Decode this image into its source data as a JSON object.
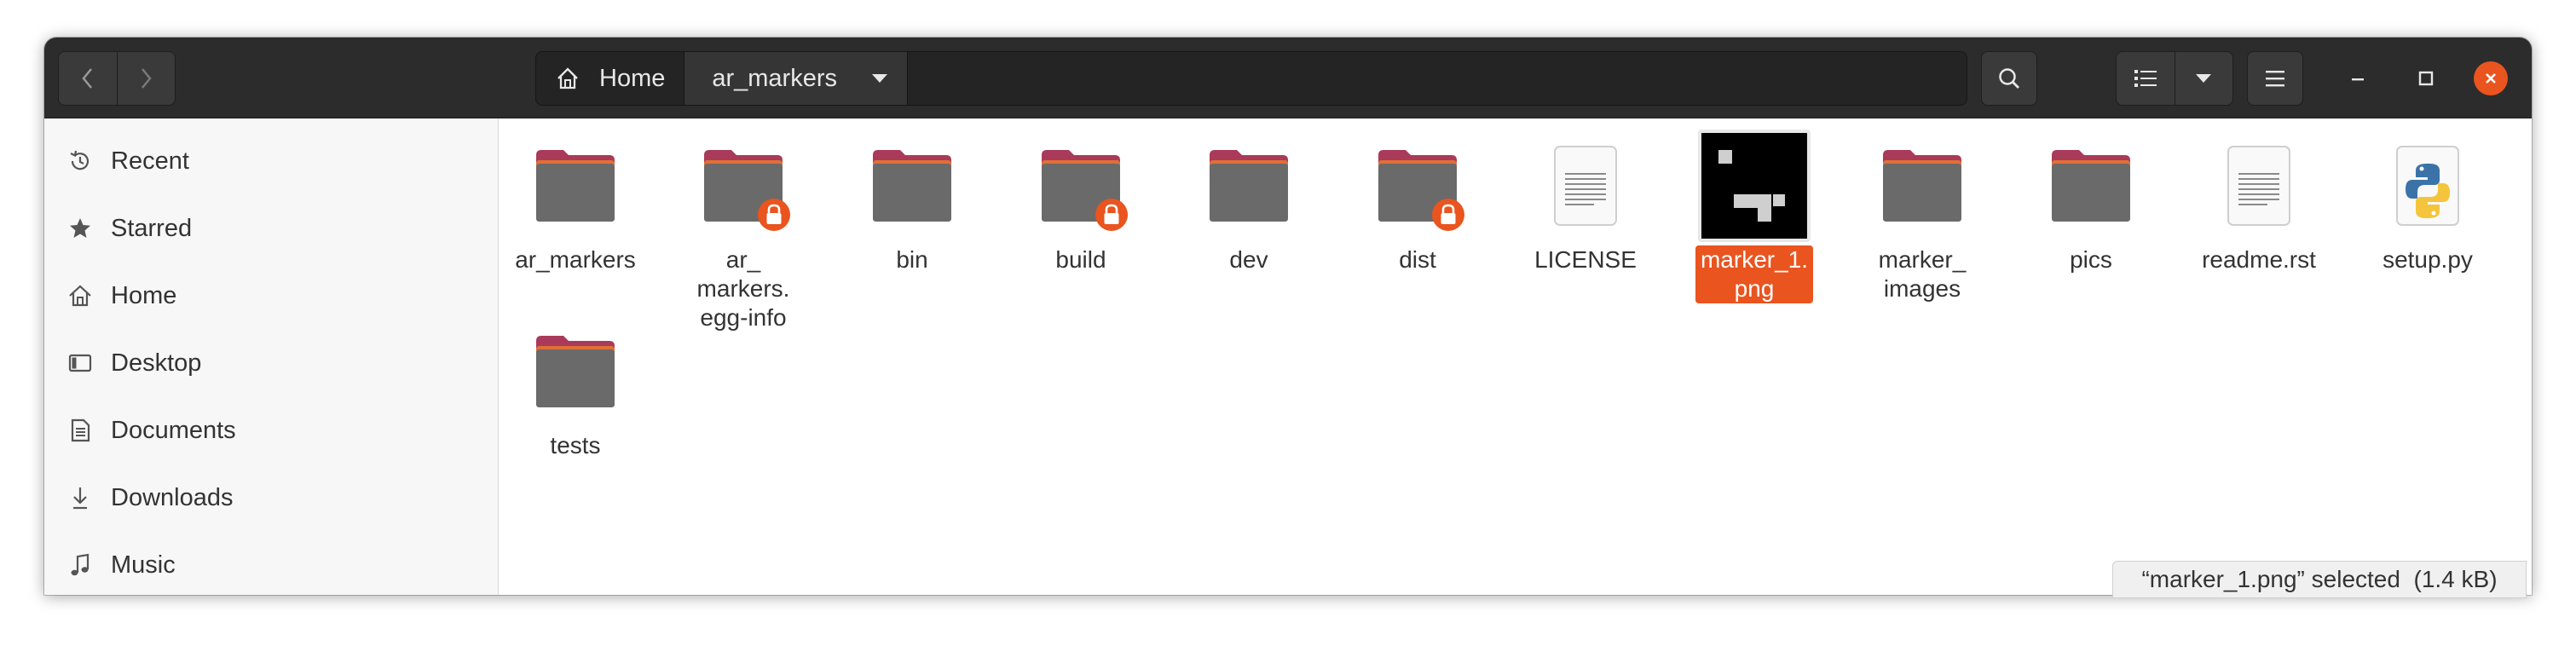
{
  "pathbar": {
    "home_label": "Home",
    "current_label": "ar_markers"
  },
  "sidebar": {
    "items": [
      {
        "label": "Recent",
        "icon": "clock-icon"
      },
      {
        "label": "Starred",
        "icon": "star-icon"
      },
      {
        "label": "Home",
        "icon": "home-icon"
      },
      {
        "label": "Desktop",
        "icon": "desktop-icon"
      },
      {
        "label": "Documents",
        "icon": "document-icon"
      },
      {
        "label": "Downloads",
        "icon": "download-icon"
      },
      {
        "label": "Music",
        "icon": "music-icon"
      }
    ]
  },
  "files": [
    {
      "lines": [
        "ar_markers"
      ],
      "type": "folder",
      "locked": false
    },
    {
      "lines": [
        "ar_",
        "markers.",
        "egg-info"
      ],
      "type": "folder",
      "locked": true
    },
    {
      "lines": [
        "bin"
      ],
      "type": "folder",
      "locked": false
    },
    {
      "lines": [
        "build"
      ],
      "type": "folder",
      "locked": true
    },
    {
      "lines": [
        "dev"
      ],
      "type": "folder",
      "locked": false
    },
    {
      "lines": [
        "dist"
      ],
      "type": "folder",
      "locked": true
    },
    {
      "lines": [
        "LICENSE"
      ],
      "type": "text",
      "locked": false
    },
    {
      "lines": [
        "marker_1.",
        "png"
      ],
      "type": "image",
      "locked": false,
      "selected": true
    },
    {
      "lines": [
        "marker_",
        "images"
      ],
      "type": "folder",
      "locked": false
    },
    {
      "lines": [
        "pics"
      ],
      "type": "folder",
      "locked": false
    },
    {
      "lines": [
        "readme.rst"
      ],
      "type": "text",
      "locked": false
    },
    {
      "lines": [
        "setup.py"
      ],
      "type": "python",
      "locked": false
    },
    {
      "lines": [
        "tests"
      ],
      "type": "folder",
      "locked": false
    }
  ],
  "status": {
    "text": "“marker_1.png” selected  (1.4 kB)"
  },
  "colors": {
    "accent": "#e9541f",
    "headerbar": "#2c2c2c",
    "folder_tab": "#a93a5a",
    "folder_body": "#6a6a6a"
  }
}
